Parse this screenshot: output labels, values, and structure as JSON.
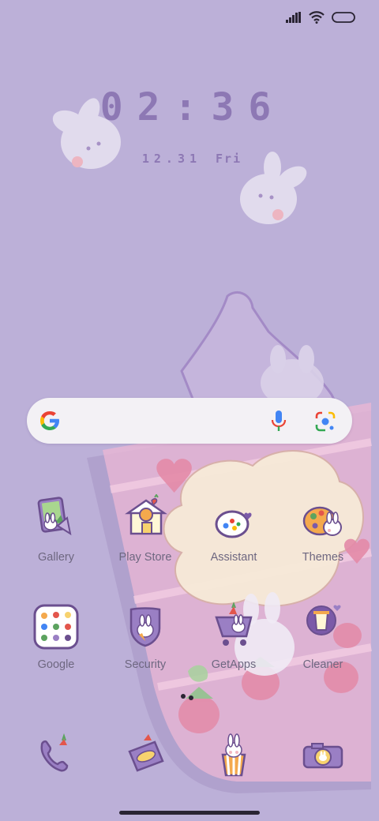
{
  "status_bar": {
    "icons": [
      "signal-icon",
      "wifi-icon",
      "battery-icon"
    ]
  },
  "clock": {
    "time": "02:36",
    "date": "12.31",
    "day": "Fri"
  },
  "search": {
    "icons": [
      "google-g-icon",
      "microphone-icon",
      "google-lens-icon"
    ]
  },
  "apps": {
    "row1": [
      {
        "label": "Gallery",
        "icon": "gallery-icon"
      },
      {
        "label": "Play Store",
        "icon": "play-store-icon"
      },
      {
        "label": "Assistant",
        "icon": "assistant-icon"
      },
      {
        "label": "Themes",
        "icon": "themes-palette-icon"
      }
    ],
    "row2": [
      {
        "label": "Google",
        "icon": "google-folder-icon"
      },
      {
        "label": "Security",
        "icon": "security-shield-icon"
      },
      {
        "label": "GetApps",
        "icon": "getapps-cart-icon"
      },
      {
        "label": "Cleaner",
        "icon": "cleaner-bin-icon"
      }
    ]
  },
  "dock": [
    {
      "icon": "phone-icon"
    },
    {
      "icon": "messages-icon"
    },
    {
      "icon": "camera-popcorn-icon"
    },
    {
      "icon": "camera-icon"
    }
  ],
  "colors": {
    "background": "#bcb0d8",
    "clock": "#8d78b4",
    "label": "#6e6780",
    "search_bg": "#f3f1f5"
  }
}
